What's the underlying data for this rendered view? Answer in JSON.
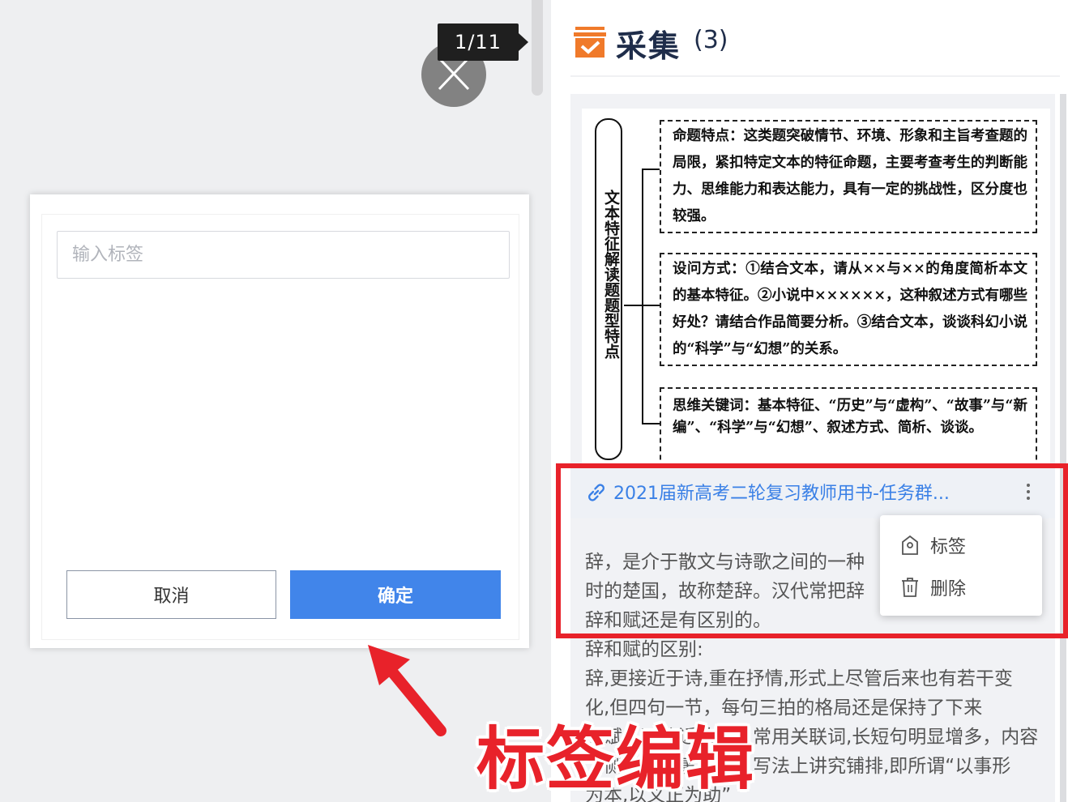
{
  "viewer": {
    "page_counter": "1/11"
  },
  "tag_dialog": {
    "input_placeholder": "输入标签",
    "cancel_label": "取消",
    "confirm_label": "确定"
  },
  "collect_panel": {
    "title": "采集",
    "count": "(3)",
    "accent_color": "#f07a2a",
    "doc_image": {
      "side_label": "文本特征解读题题型特点",
      "box1": "命题特点：这类题突破情节、环境、形象和主旨考查题的局限，紧扣特定文本的特征命题，主要考查考生的判断能力、思维能力和表达能力，具有一定的挑战性，区分度也较强。",
      "box2": "设问方式：①结合文本，请从××与××的角度简析本文的基本特征。②小说中××××××，这种叙述方式有哪些好处？请结合作品简要分析。③结合文本，谈谈科幻小说的“科学”与“幻想”的关系。",
      "box3": "思维关键词：基本特征、“历史”与“虚构”、“故事”与“新编”、“科学”与“幻想”、叙述方式、简析、谈谈。"
    },
    "source_link": "2021届新高考二轮复习教师用书-任务群...",
    "article_lines": [
      "辞，是介于散文与诗歌之间的一种",
      "时的楚国，故称楚辞。汉代常把辞",
      "辞和赋还是有区别的。",
      "辞和赋的区别:",
      "辞,更接近于诗,重在抒情,形式上尽管后来也有若干变",
      "化,但四句一节，每句三拍的格局还是保持了下来",
      "。赋，更接近散文，常用关联词,长短句明显增多，内容",
      "上侧重于叙事状物，写法上讲究铺排,即所谓“以事形",
      "为本,以义正为助”"
    ],
    "context_menu": [
      {
        "label": "标签",
        "icon": "tag-icon"
      },
      {
        "label": "删除",
        "icon": "trash-icon"
      }
    ]
  },
  "annotation": {
    "caption": "标签编辑",
    "color": "#e8222a"
  }
}
